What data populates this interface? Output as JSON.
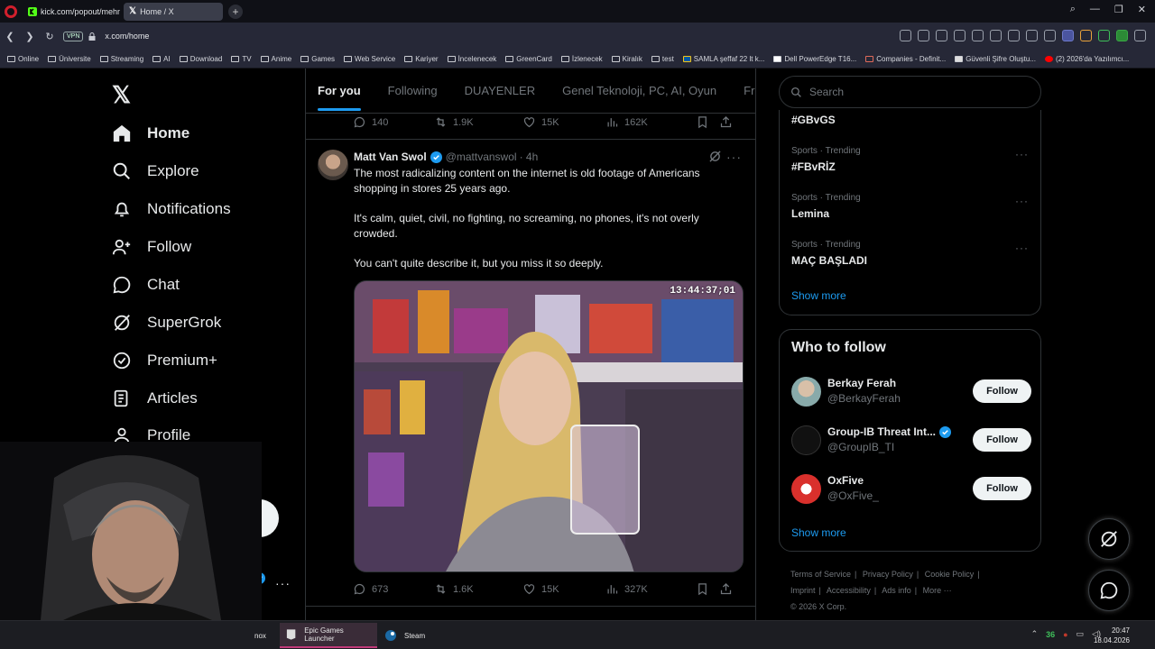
{
  "browser": {
    "tabs": [
      {
        "title": "kick.com/popout/mehme"
      },
      {
        "title": "Home / X"
      }
    ],
    "url": "x.com/home",
    "vpn_label": "VPN",
    "bookmarks": [
      "Online",
      "Üniversite",
      "Streaming",
      "AI",
      "Download",
      "TV",
      "Anime",
      "Games",
      "Web Service",
      "Kariyer",
      "İncelenecek",
      "GreenCard",
      "İzlenecek",
      "Kiralık",
      "test",
      "SAMLA şeffaf 22 lt k...",
      "Dell PowerEdge T16...",
      "Companies - Definit...",
      "Güvenli Şifre Oluştu...",
      "(2) 2026'da Yazılımcı..."
    ]
  },
  "nav": {
    "items": [
      {
        "label": "Home",
        "icon": "home-icon"
      },
      {
        "label": "Explore",
        "icon": "search-icon"
      },
      {
        "label": "Notifications",
        "icon": "bell-icon"
      },
      {
        "label": "Follow",
        "icon": "follow-icon"
      },
      {
        "label": "Chat",
        "icon": "chat-icon"
      },
      {
        "label": "SuperGrok",
        "icon": "grok-icon"
      },
      {
        "label": "Premium+",
        "icon": "premium-icon"
      },
      {
        "label": "Articles",
        "icon": "articles-icon"
      },
      {
        "label": "Profile",
        "icon": "profile-icon"
      }
    ]
  },
  "feed": {
    "tabs": [
      "For you",
      "Following",
      "DUAYENLER",
      "Genel Teknoloji, PC, AI, Oyun",
      "Free G"
    ],
    "prev_tweet_actions": {
      "replies": "140",
      "reposts": "1.9K",
      "likes": "15K",
      "views": "162K"
    },
    "tweet": {
      "name": "Matt Van Swol",
      "handle": "@mattvanswol",
      "time": "· 4h",
      "text": [
        "The most radicalizing content on the internet is old footage of Americans shopping in stores 25 years ago.",
        "It's calm, quiet, civil, no fighting, no screaming, no phones, it's not overly crowded.",
        "You can't quite describe it, but you miss it so deeply."
      ],
      "video_timecode": "13:44:37;01",
      "actions": {
        "replies": "673",
        "reposts": "1.6K",
        "likes": "15K",
        "views": "327K"
      }
    }
  },
  "right": {
    "search_placeholder": "Search",
    "trends": [
      {
        "meta": "",
        "name": "#GBvGS"
      },
      {
        "meta": "Sports · Trending",
        "name": "#FBvRİZ"
      },
      {
        "meta": "Sports · Trending",
        "name": "Lemina"
      },
      {
        "meta": "Sports · Trending",
        "name": "MAÇ BAŞLADI"
      }
    ],
    "show_more": "Show more",
    "who_to_follow_title": "Who to follow",
    "who_to_follow": [
      {
        "name": "Berkay Ferah",
        "handle": "@BerkayFerah",
        "button": "Follow"
      },
      {
        "name": "Group-IB Threat Int...",
        "handle": "@GroupIB_TI",
        "button": "Follow"
      },
      {
        "name": "OxFive",
        "handle": "@OxFive_",
        "button": "Follow"
      }
    ],
    "footer": [
      "Terms of Service",
      "|",
      "Privacy Policy",
      "|",
      "Cookie Policy",
      "|",
      "Imprint",
      "|",
      "Accessibility",
      "|",
      "Ads info",
      "|",
      "More ···",
      "© 2026 X Corp."
    ]
  },
  "taskbar": {
    "apps": [
      "Epic Games Launcher",
      "Steam"
    ],
    "partial_label": "nox",
    "tray_badge": "36",
    "time": "20:47",
    "date": "18.04.2026"
  },
  "colors": {
    "accent": "#1d9bf0",
    "background": "#000000",
    "muted": "#71767b"
  }
}
